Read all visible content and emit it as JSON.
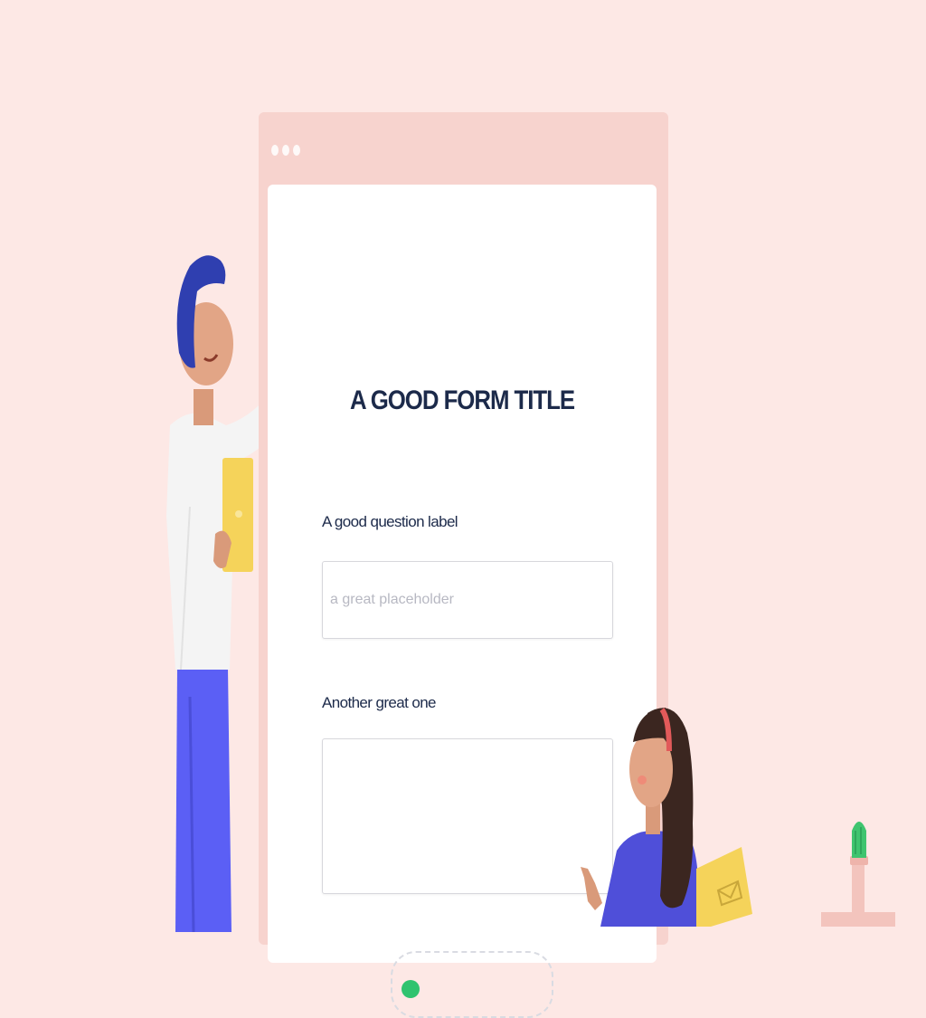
{
  "form": {
    "title": "A GOOD FORM TITLE",
    "question1": {
      "label": "A good question label",
      "placeholder": "a great placeholder",
      "value": ""
    },
    "question2": {
      "label": "Another great one",
      "value": ""
    }
  },
  "colors": {
    "background": "#fde8e5",
    "window": "#f7d3ce",
    "title_text": "#1c2a4a",
    "accent_green": "#2fc36f"
  },
  "icons": {
    "window_controls": "three-dots-icon",
    "submit": "green-circle-icon"
  }
}
